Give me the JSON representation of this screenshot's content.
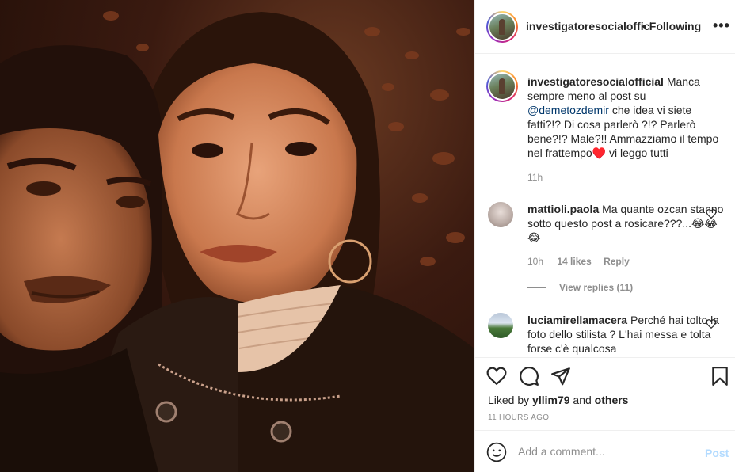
{
  "header": {
    "username": "investigatoresocialofficial",
    "separator": "•",
    "follow_label": "Following",
    "more_label": "•••"
  },
  "caption": {
    "username": "investigatoresocialofficial",
    "text_before_mention": "Manca sempre meno al post su",
    "mention": "@demetozdemir",
    "text_after_mention": "che idea vi siete fatti?!? Di cosa parlerò ?!? Parlerò bene?!? Male?!! Ammazziamo il tempo nel frattempo♥️ vi leggo tutti",
    "time": "11h"
  },
  "comments": [
    {
      "username": "mattioli.paola",
      "text": "Ma quante ozcan stanno sotto questo post a rosicare???...😂😂😂",
      "time": "10h",
      "likes": "14 likes",
      "reply_label": "Reply",
      "view_replies": "View replies (11)"
    },
    {
      "username": "luciamirellamacera",
      "text": "Perché hai tolto la foto dello stilista ? L'hai messa e tolta forse c'è qualcosa"
    }
  ],
  "actions": {
    "liked_prefix": "Liked by",
    "liked_user": "yllim79",
    "liked_and": "and",
    "liked_others": "others",
    "timestamp": "11 HOURS AGO"
  },
  "add_comment": {
    "placeholder": "Add a comment...",
    "post_label": "Post"
  },
  "colors": {
    "link": "#00376b",
    "muted": "#8e8e8e",
    "post_disabled": "#b3dbff"
  }
}
